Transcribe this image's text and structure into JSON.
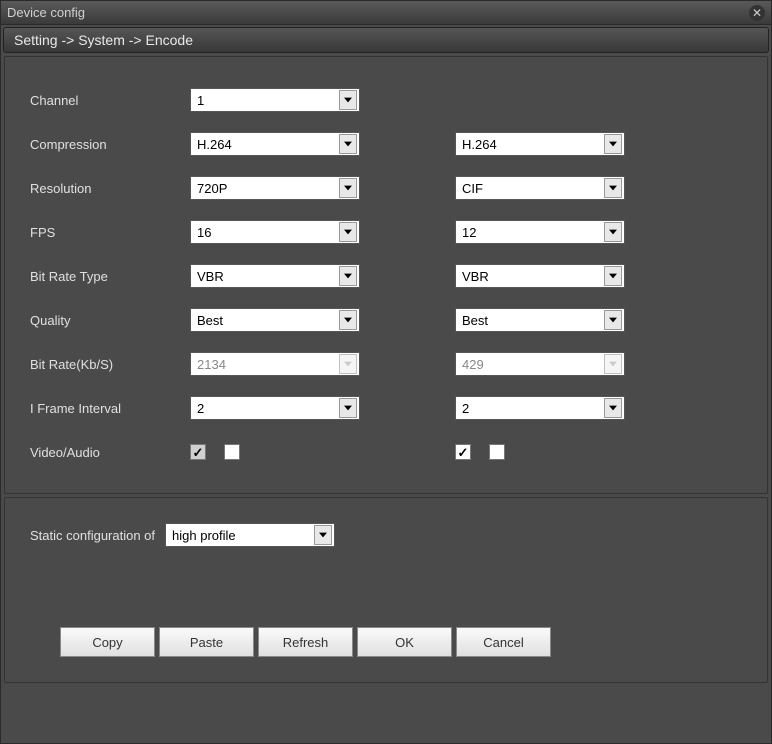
{
  "window": {
    "title": "Device config"
  },
  "breadcrumb": "Setting -> System -> Encode",
  "labels": {
    "channel": "Channel",
    "compression": "Compression",
    "resolution": "Resolution",
    "fps": "FPS",
    "bitratetype": "Bit Rate Type",
    "quality": "Quality",
    "bitrate": "Bit Rate(Kb/S)",
    "iframe": "I Frame Interval",
    "videoaudio": "Video/Audio",
    "staticconfig": "Static configuration of"
  },
  "main": {
    "channel": "1",
    "compression": "H.264",
    "resolution": "720P",
    "fps": "16",
    "bitratetype": "VBR",
    "quality": "Best",
    "bitrate": "2134",
    "iframe": "2",
    "video_checked": true,
    "audio_checked": false
  },
  "extra": {
    "compression": "H.264",
    "resolution": "CIF",
    "fps": "12",
    "bitratetype": "VBR",
    "quality": "Best",
    "bitrate": "429",
    "iframe": "2",
    "video_checked": true,
    "audio_checked": false
  },
  "static": {
    "profile": "high profile"
  },
  "buttons": {
    "copy": "Copy",
    "paste": "Paste",
    "refresh": "Refresh",
    "ok": "OK",
    "cancel": "Cancel"
  }
}
